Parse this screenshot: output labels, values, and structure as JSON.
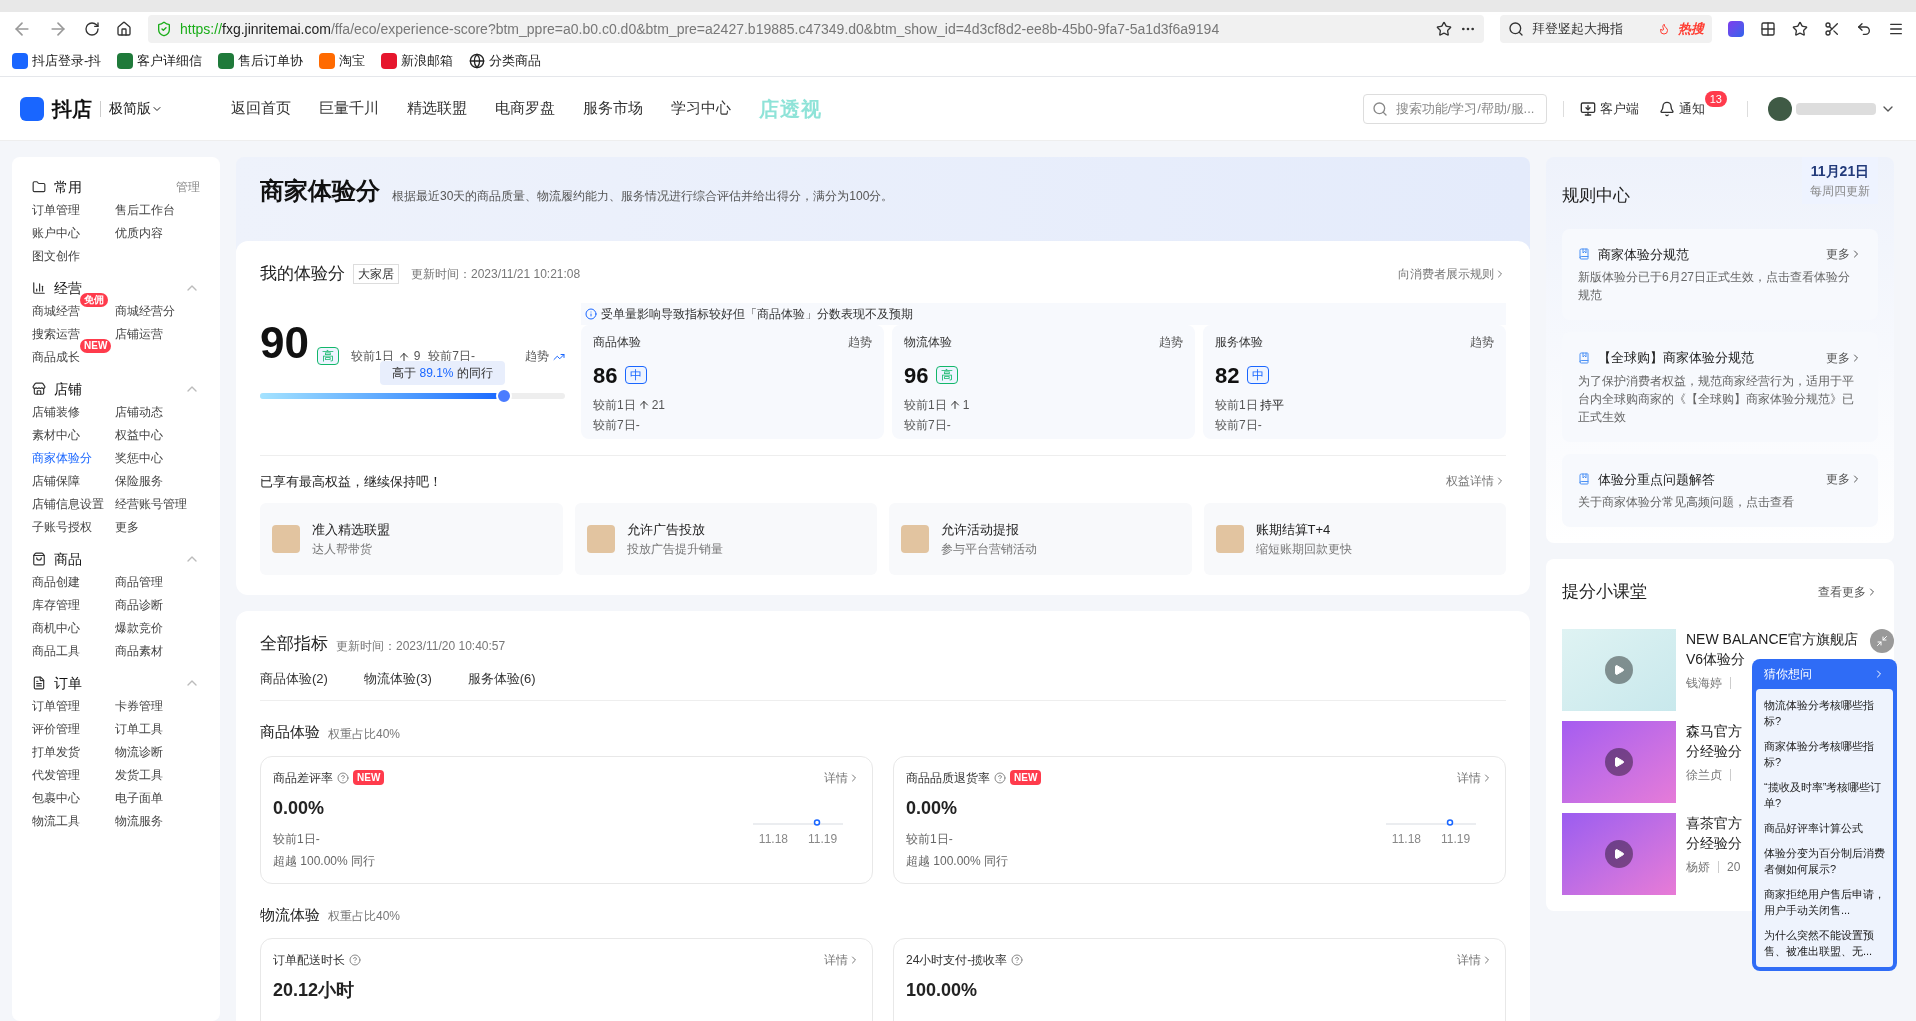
{
  "browser": {
    "url_scheme": "https://",
    "url_host": "fxg.jinritemai.com",
    "url_path": "/ffa/eco/experience-score?btm_ppre=a0.b0.c0.d0&btm_pre=a2427.b19885.c47349.d0&btm_show_id=4d3cf8d2-ee8b-45b0-9fa7-5a1d3f6a9194",
    "search": "拜登竖起大拇指",
    "hot_label": "热搜",
    "bookmarks": [
      "抖店登录-抖",
      "客户详细信",
      "售后订单协",
      "淘宝",
      "新浪邮箱",
      "分类商品"
    ]
  },
  "header": {
    "brand": "抖店",
    "edition": "极简版",
    "nav": [
      "返回首页",
      "巨量千川",
      "精选联盟",
      "电商罗盘",
      "服务市场",
      "学习中心"
    ],
    "promo_logo": "店透视",
    "search_placeholder": "搜索功能/学习/帮助/服...",
    "client": "客户端",
    "notice": "通知",
    "notice_count": "13"
  },
  "sidebar": [
    {
      "title": "常用",
      "action": "管理",
      "items": [
        {
          "label": "订单管理",
          "selected": false
        },
        {
          "label": "售后工作台",
          "selected": false
        },
        {
          "label": "账户中心",
          "selected": false
        },
        {
          "label": "优质内容",
          "selected": false
        },
        {
          "label": "图文创作",
          "selected": false
        }
      ]
    },
    {
      "title": "经营",
      "expanded": true,
      "items": [
        {
          "label": "商城经营",
          "badge": "免佣",
          "selected": false
        },
        {
          "label": "商城经营分",
          "selected": false
        },
        {
          "label": "搜索运营",
          "selected": false
        },
        {
          "label": "店铺运营",
          "selected": false
        },
        {
          "label": "商品成长",
          "badge": "NEW",
          "selected": false
        }
      ]
    },
    {
      "title": "店铺",
      "expanded": true,
      "items": [
        {
          "label": "店铺装修",
          "selected": false
        },
        {
          "label": "店铺动态",
          "selected": false
        },
        {
          "label": "素材中心",
          "selected": false
        },
        {
          "label": "权益中心",
          "selected": false
        },
        {
          "label": "商家体验分",
          "selected": true
        },
        {
          "label": "奖惩中心",
          "selected": false
        },
        {
          "label": "店铺保障",
          "selected": false
        },
        {
          "label": "保险服务",
          "selected": false
        },
        {
          "label": "店铺信息设置",
          "selected": false
        },
        {
          "label": "经营账号管理",
          "selected": false
        },
        {
          "label": "子账号授权",
          "selected": false
        },
        {
          "label": "更多",
          "selected": false
        }
      ]
    },
    {
      "title": "商品",
      "expanded": true,
      "items": [
        {
          "label": "商品创建",
          "selected": false
        },
        {
          "label": "商品管理",
          "selected": false
        },
        {
          "label": "库存管理",
          "selected": false
        },
        {
          "label": "商品诊断",
          "selected": false
        },
        {
          "label": "商机中心",
          "selected": false
        },
        {
          "label": "爆款竞价",
          "selected": false
        },
        {
          "label": "商品工具",
          "selected": false
        },
        {
          "label": "商品素材",
          "selected": false
        }
      ]
    },
    {
      "title": "订单",
      "expanded": true,
      "items": [
        {
          "label": "订单管理",
          "selected": false
        },
        {
          "label": "卡券管理",
          "selected": false
        },
        {
          "label": "评价管理",
          "selected": false
        },
        {
          "label": "订单工具",
          "selected": false
        },
        {
          "label": "打单发货",
          "selected": false
        },
        {
          "label": "物流诊断",
          "selected": false
        },
        {
          "label": "代发管理",
          "selected": false
        },
        {
          "label": "发货工具",
          "selected": false
        },
        {
          "label": "包裹中心",
          "selected": false
        },
        {
          "label": "电子面单",
          "selected": false
        },
        {
          "label": "物流工具",
          "selected": false
        },
        {
          "label": "物流服务",
          "selected": false
        }
      ]
    }
  ],
  "banner": {
    "title": "商家体验分",
    "description": "根据最近30天的商品质量、物流履约能力、服务情况进行综合评估并给出得分，满分为100分。"
  },
  "my_score": {
    "title": "我的体验分",
    "category": "大家居",
    "updated": "更新时间：2023/11/21 10:21:08",
    "rules_link": "向消费者展示规则",
    "score": "90",
    "grade": {
      "text": "高",
      "color": "#12b76a"
    },
    "vs_day": "较前1日",
    "vs_day_value": "9",
    "vs_week": "较前7日-",
    "trend": "趋势",
    "percentile_prefix": "高于",
    "percentile": "89.1%",
    "percentile_suffix": "的同行",
    "level": 0.8,
    "notice": "受单量影响导致指标较好但「商品体验」分数表现不及预期",
    "parts": [
      {
        "name": "商品体验",
        "trend": "趋势",
        "score": "86",
        "grade": "中",
        "color": "#1966ff",
        "day_prefix": "较前1日",
        "day_up": true,
        "day_value": "21",
        "week": "较前7日-"
      },
      {
        "name": "物流体验",
        "trend": "趋势",
        "score": "96",
        "grade": "高",
        "color": "#12b76a",
        "day_prefix": "较前1日",
        "day_up": true,
        "day_value": "1",
        "week": "较前7日-"
      },
      {
        "name": "服务体验",
        "trend": "趋势",
        "score": "82",
        "grade": "中",
        "color": "#1966ff",
        "day_prefix": "较前1日",
        "day_up": false,
        "day_value": "持平",
        "week": "较前7日-"
      }
    ],
    "benefits_title": "已享有最高权益，继续保持吧！",
    "benefits_link": "权益详情",
    "benefits": [
      {
        "title": "准入精选联盟",
        "desc": "达人帮带货"
      },
      {
        "title": "允许广告投放",
        "desc": "投放广告提升销量"
      },
      {
        "title": "允许活动提报",
        "desc": "参与平台营销活动"
      },
      {
        "title": "账期结算T+4",
        "desc": "缩短账期回款更快"
      }
    ]
  },
  "metrics": {
    "title": "全部指标",
    "updated": "更新时间：2023/11/20 10:40:57",
    "tabs": [
      "商品体验(2)",
      "物流体验(3)",
      "服务体验(6)"
    ],
    "groups": [
      {
        "title": "商品体验",
        "weight": "权重占比40%",
        "cards": [
          {
            "name": "商品差评率",
            "badge": "NEW",
            "link": "详情",
            "value": "0.00%",
            "day": "较前1日-",
            "beat": "超越 100.00% 同行",
            "x_labels": [
              "11.18",
              "11.19"
            ]
          },
          {
            "name": "商品品质退货率",
            "badge": "NEW",
            "link": "详情",
            "value": "0.00%",
            "day": "较前1日-",
            "beat": "超越 100.00% 同行",
            "x_labels": [
              "11.18",
              "11.19"
            ]
          }
        ]
      },
      {
        "title": "物流体验",
        "weight": "权重占比40%",
        "cards": [
          {
            "name": "订单配送时长",
            "link": "详情",
            "value": "20.12小时"
          },
          {
            "name": "24小时支付-揽收率",
            "link": "详情",
            "value": "100.00%"
          }
        ]
      }
    ]
  },
  "date_badge": {
    "date": "11月21日",
    "note": "每周四更新"
  },
  "rules": {
    "title": "规则中心",
    "items": [
      {
        "title": "商家体验分规范",
        "more": "更多",
        "desc": "新版体验分已于6月27日正式生效，点击查看体验分规范"
      },
      {
        "title": "【全球购】商家体验分规范",
        "more": "更多",
        "desc": "为了保护消费者权益，规范商家经营行为，适用于平台内全球购商家的《【全球购】商家体验分规范》已正式生效"
      },
      {
        "title": "体验分重点问题解答",
        "more": "更多",
        "desc": "关于商家体验分常见高频问题，点击查看"
      }
    ]
  },
  "classroom": {
    "title": "提分小课堂",
    "more": "查看更多",
    "videos": [
      {
        "title": "NEW BALANCE官方旗舰店",
        "title_2": "V6体验分",
        "author": "钱海婷"
      },
      {
        "title": "森马官方",
        "title_2": "分经验分",
        "author": "徐兰贞"
      },
      {
        "title": "喜茶官方",
        "title_2": "分经验分",
        "author": "杨娇",
        "date": "20"
      }
    ]
  },
  "faq": {
    "title": "猜你想问",
    "questions": [
      "物流体验分考核哪些指标?",
      "商家体验分考核哪些指标?",
      "“揽收及时率”考核哪些订单?",
      "商品好评率计算公式",
      "体验分变为百分制后消费者侧如何展示?",
      "商家拒绝用户售后申请，用户手动关闭售...",
      "为什么突然不能设置预售、被准出联盟、无..."
    ]
  }
}
